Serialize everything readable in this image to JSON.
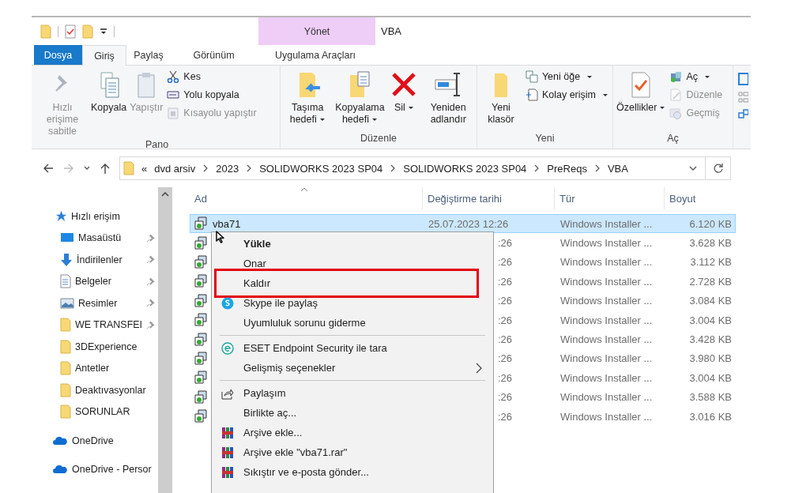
{
  "quick_access_toolbar": {
    "title": "VBA"
  },
  "contextual_tab_group": {
    "label": "Yönet"
  },
  "tabs": [
    {
      "label": "Dosya",
      "kind": "file",
      "selected": false
    },
    {
      "label": "Giriş",
      "kind": "normal",
      "selected": true
    },
    {
      "label": "Paylaş",
      "kind": "normal",
      "selected": false
    },
    {
      "label": "Görünüm",
      "kind": "normal",
      "selected": false
    },
    {
      "label": "Uygulama Araçları",
      "kind": "contextual",
      "selected": false
    }
  ],
  "ribbon": {
    "groups": [
      {
        "label": "Pano",
        "large": [
          {
            "label": "Hızlı erişime sabitle",
            "kind": "pin",
            "disabled": true,
            "dropdown": false
          },
          {
            "label": "Kopyala",
            "kind": "copy",
            "disabled": false,
            "dropdown": false
          },
          {
            "label": "Yapıştır",
            "kind": "paste",
            "disabled": true,
            "dropdown": false
          }
        ],
        "small": [
          {
            "label": "Kes",
            "kind": "cut",
            "disabled": false,
            "dropdown": false
          },
          {
            "label": "Yolu kopyala",
            "kind": "copy-path",
            "disabled": false,
            "dropdown": false
          },
          {
            "label": "Kısayolu yapıştır",
            "kind": "paste-shortcut",
            "disabled": true,
            "dropdown": false
          }
        ]
      },
      {
        "label": "Düzenle",
        "large": [
          {
            "label": "Taşıma hedefi",
            "kind": "move",
            "disabled": false,
            "dropdown": true
          },
          {
            "label": "Kopyalama hedefi",
            "kind": "copy-to",
            "disabled": false,
            "dropdown": true
          },
          {
            "label": "Sil",
            "kind": "delete",
            "disabled": false,
            "dropdown": true
          },
          {
            "label": "Yeniden adlandır",
            "kind": "rename",
            "disabled": false,
            "dropdown": false
          }
        ]
      },
      {
        "label": "Yeni",
        "large": [
          {
            "label": "Yeni klasör",
            "kind": "new-folder",
            "disabled": false,
            "dropdown": false
          }
        ],
        "small": [
          {
            "label": "Yeni öğe",
            "kind": "new-item",
            "disabled": false,
            "dropdown": true
          },
          {
            "label": "Kolay erişim",
            "kind": "easy-access",
            "disabled": false,
            "dropdown": true
          }
        ]
      },
      {
        "label": "Aç",
        "large": [
          {
            "label": "Özellikler",
            "kind": "properties",
            "disabled": false,
            "dropdown": true
          }
        ],
        "small": [
          {
            "label": "Aç",
            "kind": "open",
            "disabled": false,
            "dropdown": true
          },
          {
            "label": "Düzenle",
            "kind": "edit",
            "disabled": true,
            "dropdown": false
          },
          {
            "label": "Geçmiş",
            "kind": "history",
            "disabled": true,
            "dropdown": false
          }
        ]
      }
    ]
  },
  "address_bar": {
    "overflow": "«",
    "crumbs": [
      "dvd arsiv",
      "2023",
      "SOLIDWORKS 2023 SP04",
      "SOLIDWORKS 2023 SP04",
      "PreReqs",
      "VBA"
    ]
  },
  "navigation_pane": {
    "items": [
      {
        "label": "Hızlı erişim",
        "kind": "quick-access",
        "children": [
          {
            "label": "Masaüstü",
            "kind": "desktop",
            "pinned": true
          },
          {
            "label": "İndirilenler",
            "kind": "downloads",
            "pinned": true
          },
          {
            "label": "Belgeler",
            "kind": "documents",
            "pinned": true
          },
          {
            "label": "Resimler",
            "kind": "pictures",
            "pinned": true
          },
          {
            "label": "WE TRANSFEI",
            "kind": "folder",
            "pinned": true
          },
          {
            "label": "3DExperience",
            "kind": "folder",
            "pinned": false
          },
          {
            "label": "Antetler",
            "kind": "folder",
            "pinned": false
          },
          {
            "label": "Deaktıvasyonlar",
            "kind": "folder",
            "pinned": false
          },
          {
            "label": "SORUNLAR",
            "kind": "folder",
            "pinned": false
          }
        ]
      },
      {
        "label": "OneDrive",
        "kind": "onedrive"
      },
      {
        "label": "OneDrive - Persor",
        "kind": "onedrive"
      }
    ]
  },
  "file_list": {
    "columns": [
      "Ad",
      "Değiştirme tarihi",
      "Tür",
      "Boyut"
    ],
    "rows": [
      {
        "name": "vba71",
        "date": "25.07.2023 12:26",
        "type": "Windows Installer ...",
        "size": "6.120 KB",
        "selected": true
      },
      {
        "date": ":26",
        "type": "Windows Installer ...",
        "size": "3.628 KB",
        "selected": false
      },
      {
        "date": ":26",
        "type": "Windows Installer ...",
        "size": "3.112 KB",
        "selected": false
      },
      {
        "date": ":26",
        "type": "Windows Installer ...",
        "size": "2.728 KB",
        "selected": false
      },
      {
        "date": ":26",
        "type": "Windows Installer ...",
        "size": "3.084 KB",
        "selected": false
      },
      {
        "date": ":26",
        "type": "Windows Installer ...",
        "size": "3.004 KB",
        "selected": false
      },
      {
        "date": ":26",
        "type": "Windows Installer ...",
        "size": "3.428 KB",
        "selected": false
      },
      {
        "date": ":26",
        "type": "Windows Installer ...",
        "size": "3.980 KB",
        "selected": false
      },
      {
        "date": ":26",
        "type": "Windows Installer ...",
        "size": "3.004 KB",
        "selected": false
      },
      {
        "date": ":26",
        "type": "Windows Installer ...",
        "size": "3.588 KB",
        "selected": false
      },
      {
        "date": ":26",
        "type": "Windows Installer ...",
        "size": "3.016 KB",
        "selected": false
      }
    ]
  },
  "context_menu": {
    "items": [
      {
        "label": "Yükle",
        "kind": "none",
        "bold": true,
        "highlighted": false,
        "submenu": false,
        "separator_before": false
      },
      {
        "label": "Onar",
        "kind": "none",
        "bold": false,
        "highlighted": false,
        "submenu": false,
        "separator_before": false
      },
      {
        "label": "Kaldır",
        "kind": "none",
        "bold": false,
        "highlighted": true,
        "submenu": false,
        "separator_before": false
      },
      {
        "label": "Skype ile paylaş",
        "kind": "skype",
        "bold": false,
        "highlighted": false,
        "submenu": false,
        "separator_before": false
      },
      {
        "label": "Uyumluluk sorunu giderme",
        "kind": "none",
        "bold": false,
        "highlighted": false,
        "submenu": false,
        "separator_before": false
      },
      {
        "label": "ESET Endpoint Security ile tara",
        "kind": "eset",
        "bold": false,
        "highlighted": false,
        "submenu": false,
        "separator_before": true
      },
      {
        "label": "Gelişmiş seçenekler",
        "kind": "none",
        "bold": false,
        "highlighted": false,
        "submenu": true,
        "separator_before": false
      },
      {
        "label": "Paylaşım",
        "kind": "share",
        "bold": false,
        "highlighted": false,
        "submenu": false,
        "separator_before": true
      },
      {
        "label": "Birlikte aç...",
        "kind": "none",
        "bold": false,
        "highlighted": false,
        "submenu": false,
        "separator_before": false
      },
      {
        "label": "Arşive ekle...",
        "kind": "winrar",
        "bold": false,
        "highlighted": false,
        "submenu": false,
        "separator_before": false
      },
      {
        "label": "Arşive ekle \"vba71.rar\"",
        "kind": "winrar",
        "bold": false,
        "highlighted": false,
        "submenu": false,
        "separator_before": false
      },
      {
        "label": "Sıkıştır ve e-posta gönder...",
        "kind": "winrar",
        "bold": false,
        "highlighted": false,
        "submenu": false,
        "separator_before": false
      }
    ]
  }
}
